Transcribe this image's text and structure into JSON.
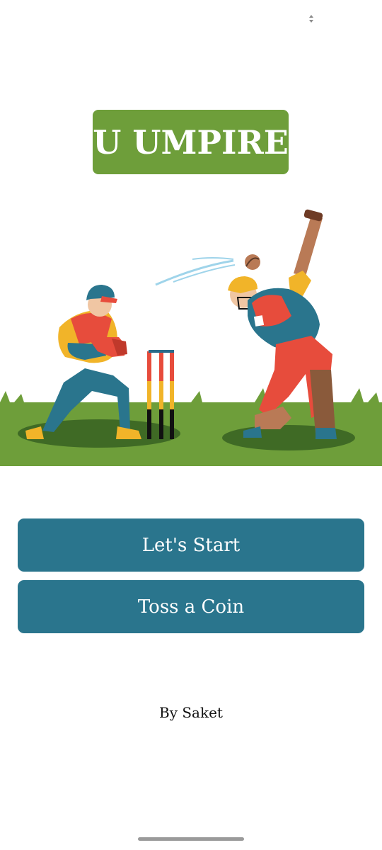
{
  "app": {
    "title": "U UMPIRE"
  },
  "buttons": {
    "start_label": "Let's Start",
    "toss_label": "Toss a Coin"
  },
  "footer": {
    "credit": "By Saket"
  },
  "colors": {
    "title_background": "#6e9e3a",
    "button_background": "#2a758d",
    "grass": "#6e9e3a"
  },
  "illustration": {
    "icon": "cricket-match-illustration"
  }
}
